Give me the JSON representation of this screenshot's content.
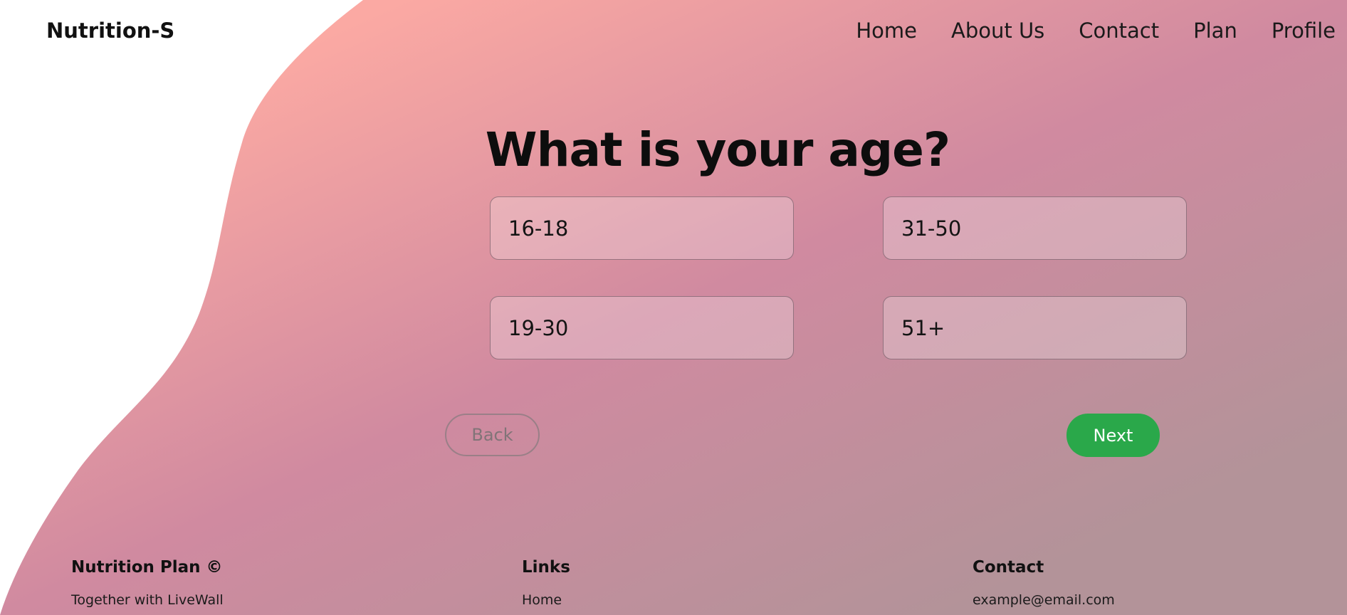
{
  "brand": {
    "logo": "Nutrition-S"
  },
  "nav": {
    "items": [
      {
        "label": "Home"
      },
      {
        "label": "About Us"
      },
      {
        "label": "Contact"
      },
      {
        "label": "Plan"
      },
      {
        "label": "Profile"
      }
    ]
  },
  "question": {
    "title": "What is your age?"
  },
  "options": [
    {
      "label": "16-18"
    },
    {
      "label": "31-50"
    },
    {
      "label": "19-30"
    },
    {
      "label": "51+"
    }
  ],
  "actions": {
    "back_label": "Back",
    "next_label": "Next"
  },
  "footer": {
    "col1": {
      "title": "Nutrition Plan ©",
      "text": "Together with LiveWall"
    },
    "col2": {
      "title": "Links",
      "link": "Home"
    },
    "col3": {
      "title": "Contact",
      "email": "example@email.com"
    }
  },
  "colors": {
    "gradient_start": "#fba9a3",
    "gradient_mid": "#d08aa0",
    "gradient_end": "#b39399",
    "next_button": "#2aa84a"
  }
}
